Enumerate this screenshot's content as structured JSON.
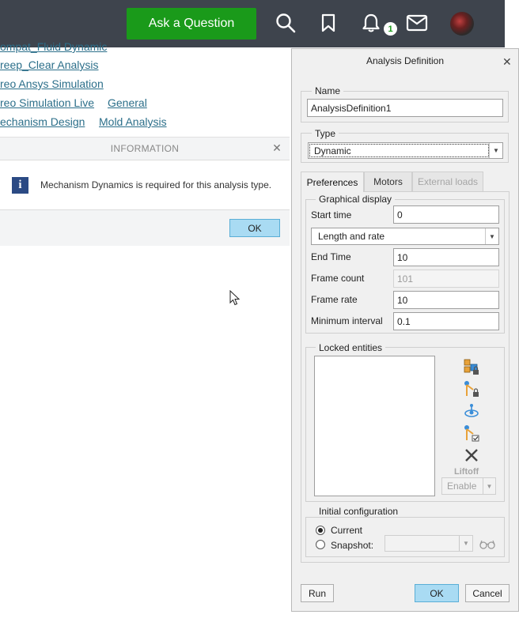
{
  "topbar": {
    "ask_label": "Ask a Question",
    "notification_count": "1"
  },
  "links": [
    "ompat_Fluid Dynamic",
    "reep_Clear Analysis",
    "reo Ansys Simulation",
    "reo Simulation Live",
    "General",
    "echanism Design",
    "Mold Analysis"
  ],
  "info_dialog": {
    "title": "INFORMATION",
    "message": "Mechanism Dynamics is required for this analysis type.",
    "ok_label": "OK"
  },
  "analysis": {
    "title": "Analysis Definition",
    "name_label": "Name",
    "name_value": "AnalysisDefinition1",
    "type_label": "Type",
    "type_value": "Dynamic",
    "tabs": [
      "Preferences",
      "Motors",
      "External loads"
    ],
    "graphical_display_label": "Graphical display",
    "start_time_label": "Start time",
    "start_time_value": "0",
    "mode_value": "Length and rate",
    "end_time_label": "End Time",
    "end_time_value": "10",
    "frame_count_label": "Frame count",
    "frame_count_value": "101",
    "frame_rate_label": "Frame rate",
    "frame_rate_value": "10",
    "min_interval_label": "Minimum interval",
    "min_interval_value": "0.1",
    "locked_entities_label": "Locked entities",
    "liftoff_label": "Liftoff",
    "enable_label": "Enable",
    "initial_config_label": "Initial configuration",
    "current_label": "Current",
    "snapshot_label": "Snapshot:",
    "run_label": "Run",
    "ok_label": "OK",
    "cancel_label": "Cancel"
  },
  "colors": {
    "topbar": "#3e444d",
    "ask_button": "#1a9a1a",
    "link": "#2c6f8a",
    "primary_button": "#a9dbf3",
    "info_icon": "#2b4a84"
  }
}
